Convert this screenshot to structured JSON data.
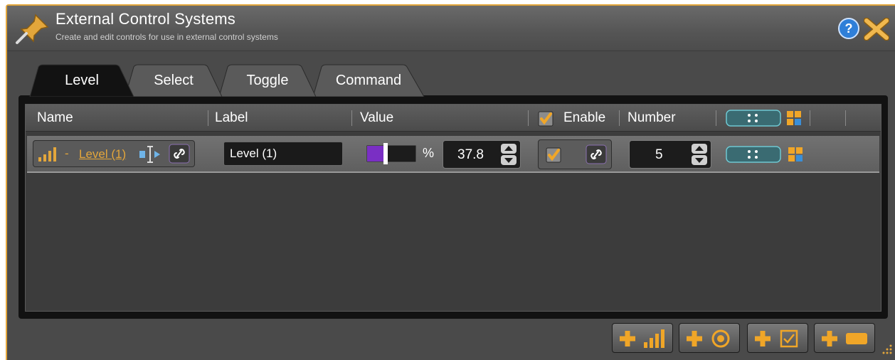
{
  "window": {
    "title": "External Control Systems",
    "subtitle": "Create and edit controls for use in external control systems",
    "icons": [
      "pin-icon",
      "help-icon",
      "close-icon"
    ]
  },
  "tabs": [
    {
      "label": "Level",
      "active": true
    },
    {
      "label": "Select",
      "active": false
    },
    {
      "label": "Toggle",
      "active": false
    },
    {
      "label": "Command",
      "active": false
    }
  ],
  "table": {
    "columns": {
      "name": "Name",
      "label": "Label",
      "value": "Value",
      "enable": "Enable",
      "number": "Number"
    },
    "enable_all_checked": true,
    "rows": [
      {
        "name": "Level (1)",
        "dash": "-",
        "label": "Level (1)",
        "value_fraction": 0.378,
        "value_unit": "%",
        "value": "37.8",
        "enabled": true,
        "number": "5"
      }
    ]
  },
  "footer": {
    "buttons": [
      "add-level-button",
      "add-select-button",
      "add-toggle-button",
      "add-command-button"
    ]
  },
  "colors": {
    "accent": "#e3a63b",
    "slider_fill": "#7a2fc4",
    "teal_button": "#3aa7b0",
    "help_blue": "#2f7fd8"
  }
}
